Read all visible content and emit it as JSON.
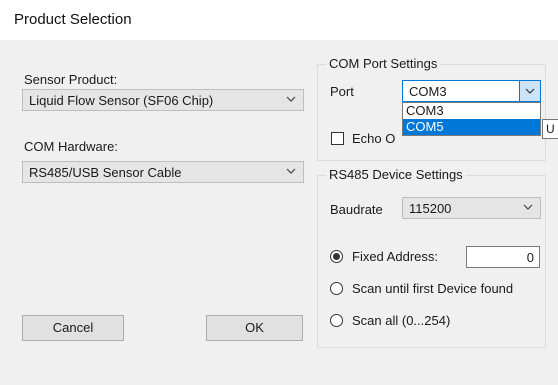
{
  "window": {
    "title": "Product Selection"
  },
  "sensor_product": {
    "label": "Sensor Product:",
    "selected": "Liquid Flow Sensor (SF06 Chip)"
  },
  "com_hardware": {
    "label": "COM Hardware:",
    "selected": "RS485/USB Sensor Cable"
  },
  "com_port_settings": {
    "legend": "COM Port Settings",
    "port_label": "Port",
    "port_selected": "COM3",
    "port_options": [
      "COM3",
      "COM5"
    ],
    "highlighted_option": "COM5",
    "echo_label": "Echo O",
    "echo_checked": false,
    "tooltip_text": "U"
  },
  "rs485_settings": {
    "legend": "RS485 Device Settings",
    "baudrate_label": "Baudrate",
    "baudrate_selected": "115200",
    "fixed_address_label": "Fixed Address:",
    "fixed_address_value": "0",
    "scan_first_label": "Scan until first Device found",
    "scan_all_label": "Scan all (0...254)",
    "selected_mode": "fixed_address"
  },
  "buttons": {
    "cancel": "Cancel",
    "ok": "OK"
  },
  "colors": {
    "highlight": "#0078d7",
    "dialog_bg": "#f0f0f0"
  }
}
